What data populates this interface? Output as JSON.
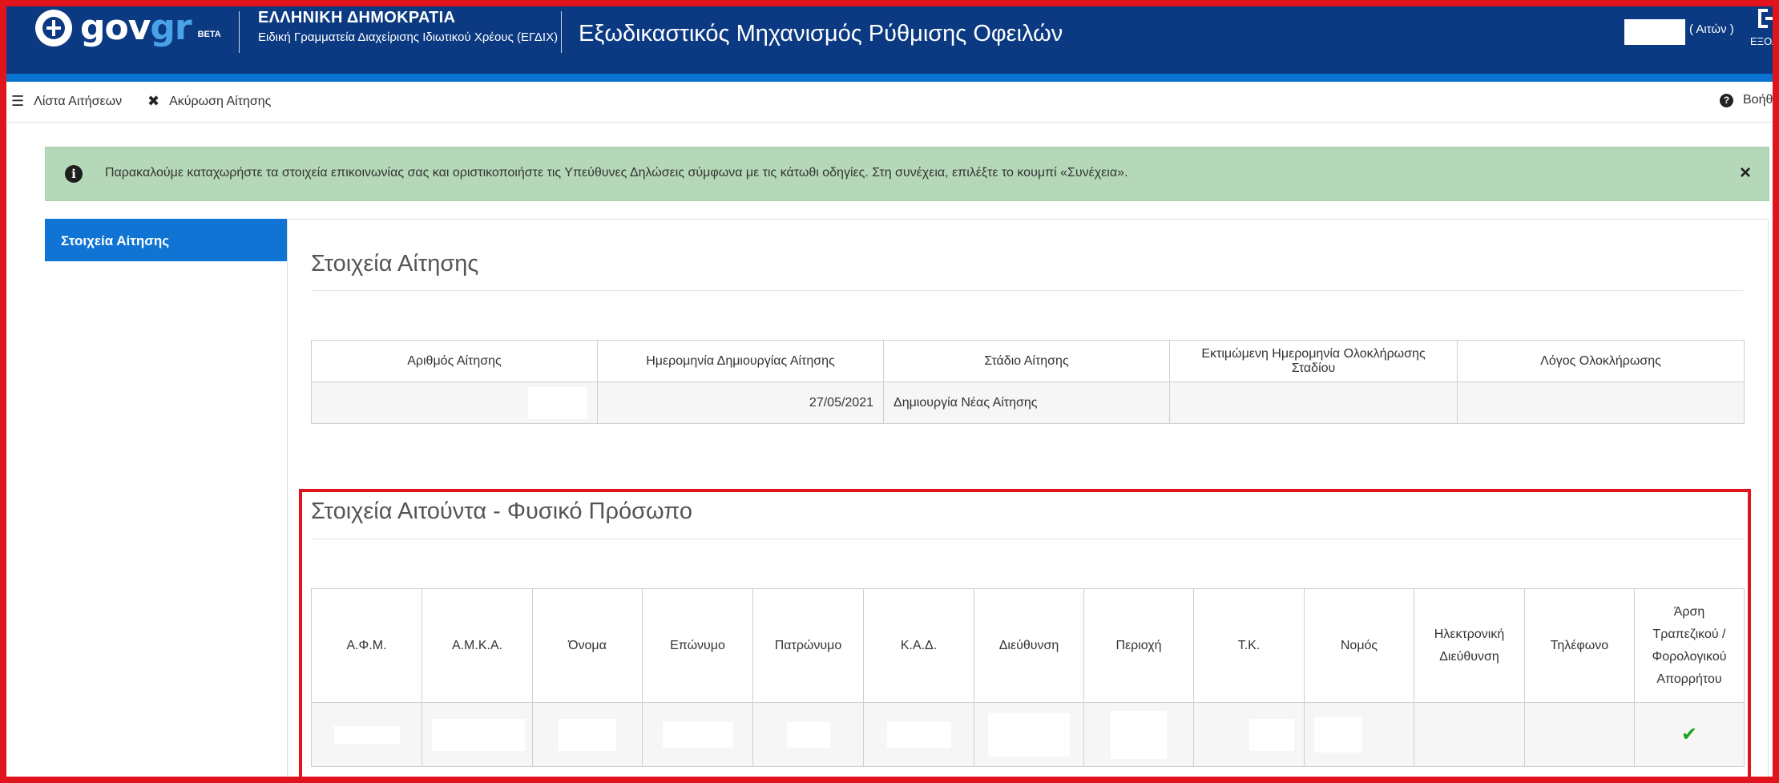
{
  "header": {
    "logo_gov": "gov",
    "logo_gr": "gr",
    "logo_beta": "BETA",
    "gov_name": "ΕΛΛΗΝΙΚΗ ΔΗΜΟΚΡΑΤΙΑ",
    "gov_sub": "Ειδική Γραμματεία Διαχείρισης Ιδιωτικού Χρέους (ΕΓΔΙΧ)",
    "app_title": "Εξωδικαστικός Μηχανισμός Ρύθμισης Οφειλών",
    "user_role": "( Αιτών )",
    "logout_label": "ΕΞΟΔΟΣ"
  },
  "toolbar": {
    "list_label": "Λίστα Αιτήσεων",
    "cancel_label": "Ακύρωση Αίτησης",
    "help_label": "Βοήθεια"
  },
  "alert": {
    "message": "Παρακαλούμε καταχωρήστε τα στοιχεία επικοινωνίας σας και οριστικοποιήστε τις Υπεύθυνες Δηλώσεις σύμφωνα με τις κάτωθι οδηγίες. Στη συνέχεια, επιλέξτε το κουμπί «Συνέχεια».",
    "close": "×"
  },
  "sidebar": {
    "items": [
      {
        "label": "Στοιχεία Αίτησης"
      }
    ]
  },
  "application": {
    "title": "Στοιχεία Αίτησης",
    "columns": [
      "Αριθμός Αίτησης",
      "Ημερομηνία Δημιουργίας Αίτησης",
      "Στάδιο Αίτησης",
      "Εκτιμώμενη Ημερομηνία Ολοκλήρωσης Σταδίου",
      "Λόγος Ολοκλήρωσης"
    ],
    "row": {
      "number": "",
      "created": "27/05/2021",
      "stage": "Δημιουργία Νέας Αίτησης",
      "estimated": "",
      "reason": ""
    }
  },
  "applicant": {
    "title": "Στοιχεία Αιτούντα - Φυσικό Πρόσωπο",
    "columns": [
      "Α.Φ.Μ.",
      "Α.Μ.Κ.Α.",
      "Όνομα",
      "Επώνυμο",
      "Πατρώνυμο",
      "Κ.Α.Δ.",
      "Διεύθυνση",
      "Περιοχή",
      "Τ.Κ.",
      "Νομός",
      "Ηλεκτρονική Διεύθυνση",
      "Τηλέφωνο",
      "Άρση Τραπεζικού / Φορολογικού Απορρήτου"
    ],
    "row": {
      "secrecy_lifted_check": "✔"
    }
  },
  "icons": {
    "list": "list-icon",
    "cancel": "close-x-icon",
    "help": "question-circle-icon",
    "info": "info-circle-icon",
    "logout": "logout-icon",
    "check": "check-icon"
  },
  "colors": {
    "header_bg": "#0b3a82",
    "header_strip": "#0873d1",
    "alert_bg": "#b5d9b8",
    "sidebar_active": "#0f74d3",
    "highlight": "#e1141d",
    "check": "#1fa21f"
  }
}
